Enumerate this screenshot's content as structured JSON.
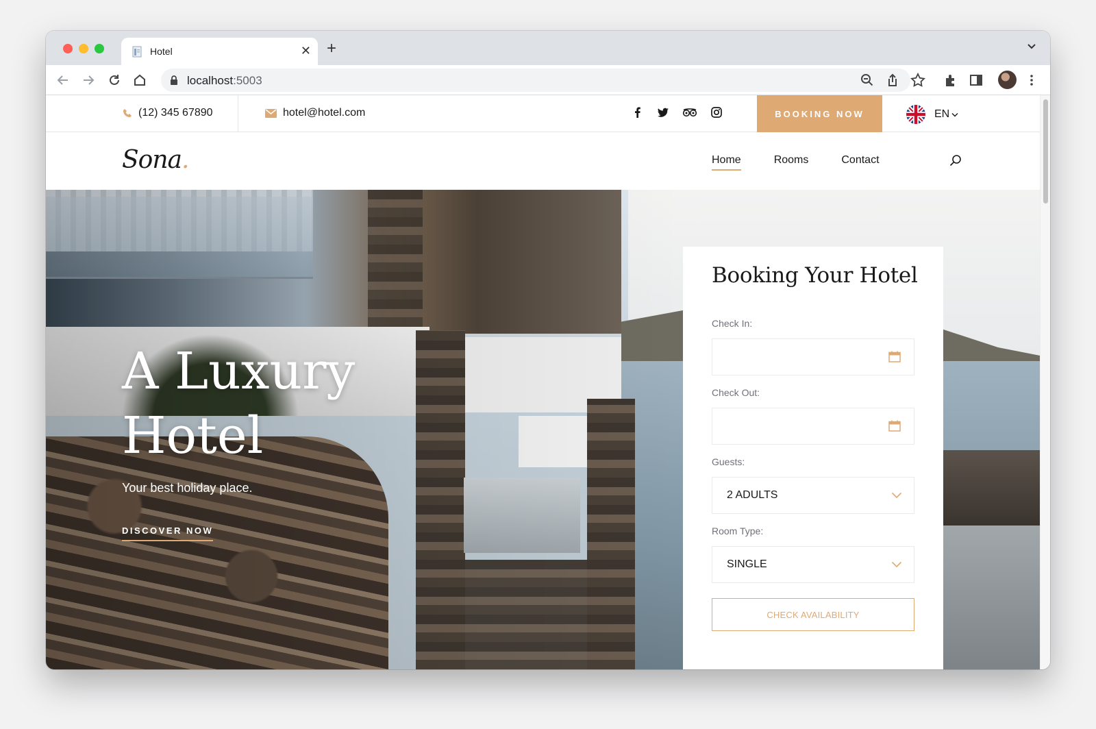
{
  "browser": {
    "tab_title": "Hotel",
    "url_host": "localhost",
    "url_port": ":5003"
  },
  "topbar": {
    "phone": "(12) 345 67890",
    "email": "hotel@hotel.com",
    "social_icons": [
      "facebook-icon",
      "twitter-icon",
      "tripadvisor-icon",
      "instagram-icon"
    ],
    "booking_label": "BOOKING NOW",
    "language": "EN"
  },
  "header": {
    "logo": "Sona",
    "logo_dot": ".",
    "nav": [
      {
        "label": "Home",
        "active": true
      },
      {
        "label": "Rooms",
        "active": false
      },
      {
        "label": "Contact",
        "active": false
      }
    ]
  },
  "hero": {
    "title_line1": "A Luxury",
    "title_line2": "Hotel",
    "subtitle": "Your best holiday place.",
    "cta": "DISCOVER NOW"
  },
  "booking": {
    "title": "Booking Your Hotel",
    "check_in_label": "Check In:",
    "check_in_value": "",
    "check_out_label": "Check Out:",
    "check_out_value": "",
    "guests_label": "Guests:",
    "guests_value": "2 ADULTS",
    "room_type_label": "Room Type:",
    "room_type_value": "SINGLE",
    "submit_label": "CHECK AVAILABILITY"
  },
  "colors": {
    "accent": "#dfa974",
    "text": "#19191a"
  }
}
